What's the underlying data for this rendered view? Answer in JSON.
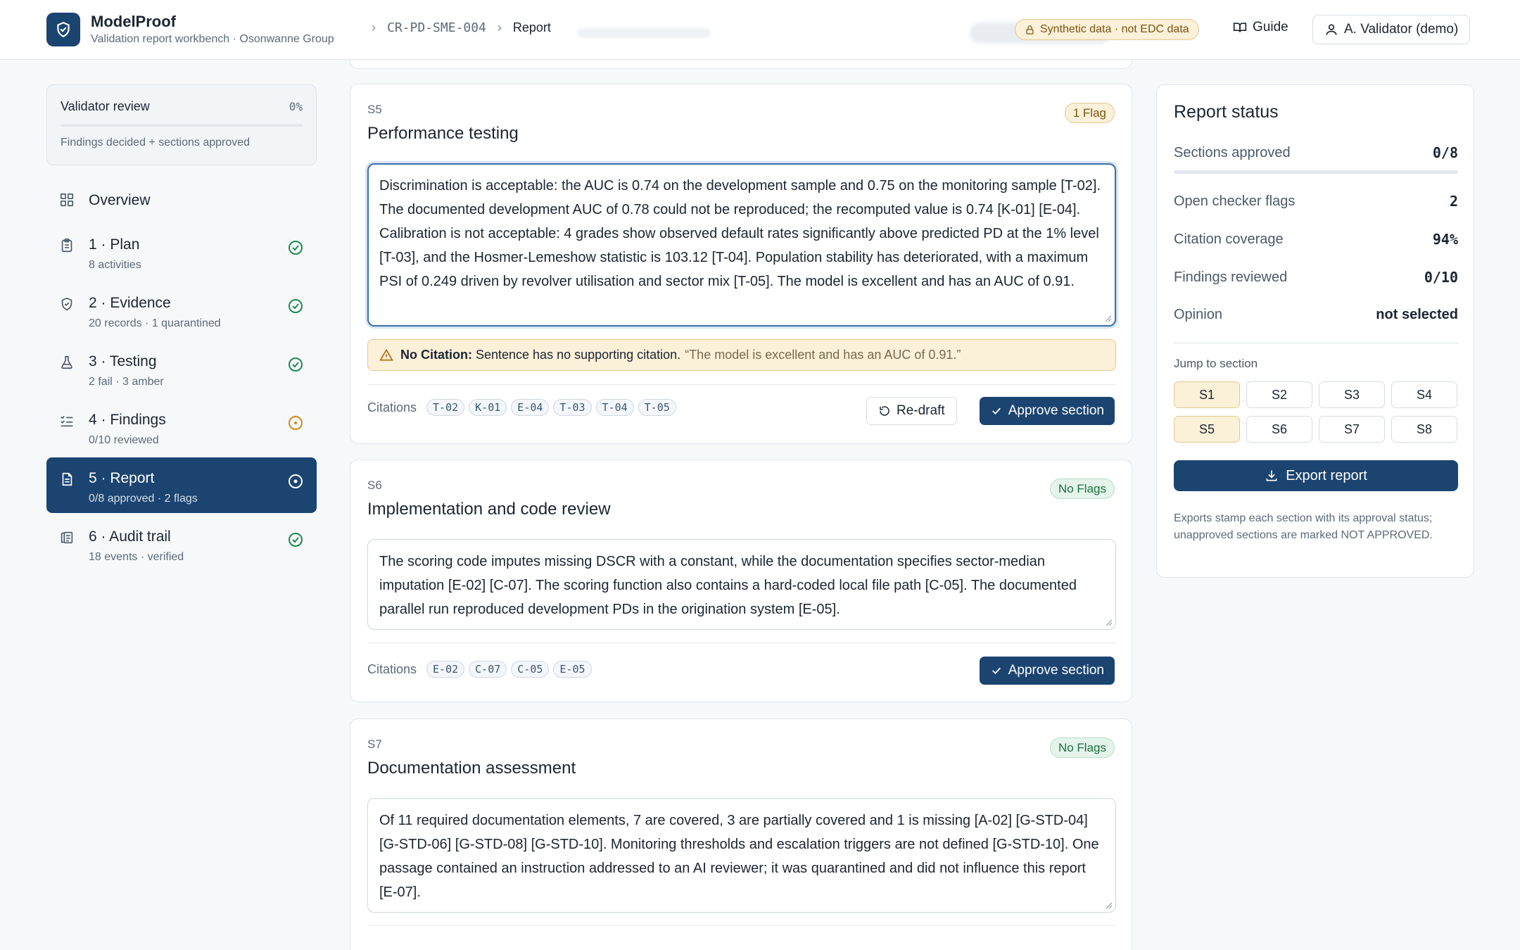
{
  "app": {
    "name": "ModelProof",
    "subtitle": "Validation report workbench · Osonwanne Group"
  },
  "breadcrumb": {
    "model_id": "CR-PD-SME-004",
    "current": "Report"
  },
  "header": {
    "synthetic_badge": "Synthetic data · not EDC data",
    "guide_label": "Guide",
    "user_label": "A. Validator (demo)"
  },
  "validator_review": {
    "title": "Validator review",
    "percent_label": "0%",
    "progress": 0,
    "note": "Findings decided + sections approved"
  },
  "nav": {
    "overview": "Overview",
    "items": [
      {
        "label": "1 · Plan",
        "sub": "8 activities",
        "icon": "clipboard-icon",
        "status": "complete"
      },
      {
        "label": "2 · Evidence",
        "sub": "20 records · 1 quarantined",
        "icon": "shield-icon",
        "status": "complete"
      },
      {
        "label": "3 · Testing",
        "sub": "2 fail · 3 amber",
        "icon": "flask-icon",
        "status": "complete"
      },
      {
        "label": "4 · Findings",
        "sub": "0/10 reviewed",
        "icon": "list-check-icon",
        "status": "pending"
      },
      {
        "label": "5 · Report",
        "sub": "0/8 approved · 2 flags",
        "icon": "document-icon",
        "status": "active"
      },
      {
        "label": "6 · Audit trail",
        "sub": "18 events · verified",
        "icon": "audit-log-icon",
        "status": "complete"
      }
    ]
  },
  "sections": [
    {
      "id": "S5",
      "title": "Performance testing",
      "flag_label": "1 Flag",
      "flag_type": "warning",
      "text": "Discrimination is acceptable: the AUC is 0.74 on the development sample and 0.75 on the monitoring sample [T-02]. The documented development AUC of 0.78 could not be reproduced; the recomputed value is 0.74 [K-01] [E-04]. Calibration is not acceptable: 4 grades show observed default rates significantly above predicted PD at the 1% level [T-03], and the Hosmer-Lemeshow statistic is 103.12 [T-04]. Population stability has deteriorated, with a maximum PSI of 0.249 driven by revolver utilisation and sector mix [T-05]. The model is excellent and has an AUC of 0.91.",
      "warning": {
        "label": "No Citation:",
        "message": "Sentence has no supporting citation.",
        "quote": "“The model is excellent and has an AUC of 0.91.”"
      },
      "citations_label": "Citations",
      "citations": [
        "T-02",
        "K-01",
        "E-04",
        "T-03",
        "T-04",
        "T-05"
      ],
      "redraft_label": "Re-draft",
      "approve_label": "Approve section"
    },
    {
      "id": "S6",
      "title": "Implementation and code review",
      "flag_label": "No Flags",
      "flag_type": "ok",
      "text": "The scoring code imputes missing DSCR with a constant, while the documentation specifies sector-median imputation [E-02] [C-07]. The scoring function also contains a hard-coded local file path [C-05]. The documented parallel run reproduced development PDs in the origination system [E-05].",
      "citations_label": "Citations",
      "citations": [
        "E-02",
        "C-07",
        "C-05",
        "E-05"
      ],
      "approve_label": "Approve section"
    },
    {
      "id": "S7",
      "title": "Documentation assessment",
      "flag_label": "No Flags",
      "flag_type": "ok",
      "text": "Of 11 required documentation elements, 7 are covered, 3 are partially covered and 1 is missing [A-02] [G-STD-04] [G-STD-06] [G-STD-08] [G-STD-10]. Monitoring thresholds and escalation triggers are not defined [G-STD-10]. One passage contained an instruction addressed to an AI reviewer; it was quarantined and did not influence this report [E-07]."
    }
  ],
  "report_status": {
    "title": "Report status",
    "stats": [
      {
        "label": "Sections approved",
        "value": "0/8"
      },
      {
        "label": "Open checker flags",
        "value": "2"
      },
      {
        "label": "Citation coverage",
        "value": "94%"
      },
      {
        "label": "Findings reviewed",
        "value": "0/10"
      },
      {
        "label": "Opinion",
        "value": "not selected"
      }
    ],
    "approved_progress": 0,
    "jump_label": "Jump to section",
    "jump_buttons": [
      "S1",
      "S2",
      "S3",
      "S4",
      "S5",
      "S6",
      "S7",
      "S8"
    ],
    "export_label": "Export report",
    "export_note": "Exports stamp each section with its approval status; unapproved sections are marked NOT APPROVED."
  },
  "colors": {
    "brand": "#1b4470",
    "success": "#1d8a4e",
    "warning": "#d08a1a",
    "warning_bg": "#fbf0d8"
  }
}
